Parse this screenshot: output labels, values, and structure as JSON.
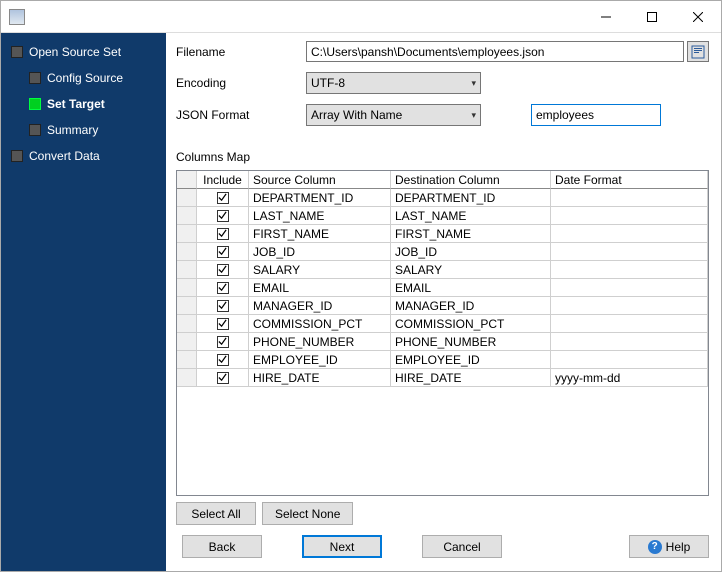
{
  "titlebar": {
    "title": ""
  },
  "sidebar": {
    "items": [
      {
        "label": "Open Source Set",
        "indent": 0,
        "active": false
      },
      {
        "label": "Config Source",
        "indent": 1,
        "active": false
      },
      {
        "label": "Set Target",
        "indent": 1,
        "active": true
      },
      {
        "label": "Summary",
        "indent": 1,
        "active": false
      },
      {
        "label": "Convert Data",
        "indent": 0,
        "active": false
      }
    ]
  },
  "form": {
    "filename_label": "Filename",
    "filename_value": "C:\\Users\\pansh\\Documents\\employees.json",
    "encoding_label": "Encoding",
    "encoding_value": "UTF-8",
    "format_label": "JSON Format",
    "format_value": "Array With Name",
    "array_name_value": "employees"
  },
  "columns_map": {
    "title": "Columns Map",
    "headers": {
      "include": "Include",
      "source": "Source Column",
      "dest": "Destination Column",
      "fmt": "Date Format"
    },
    "rows": [
      {
        "include": true,
        "src": "DEPARTMENT_ID",
        "dst": "DEPARTMENT_ID",
        "fmt": ""
      },
      {
        "include": true,
        "src": "LAST_NAME",
        "dst": "LAST_NAME",
        "fmt": ""
      },
      {
        "include": true,
        "src": "FIRST_NAME",
        "dst": "FIRST_NAME",
        "fmt": ""
      },
      {
        "include": true,
        "src": "JOB_ID",
        "dst": "JOB_ID",
        "fmt": ""
      },
      {
        "include": true,
        "src": "SALARY",
        "dst": "SALARY",
        "fmt": ""
      },
      {
        "include": true,
        "src": "EMAIL",
        "dst": "EMAIL",
        "fmt": ""
      },
      {
        "include": true,
        "src": "MANAGER_ID",
        "dst": "MANAGER_ID",
        "fmt": ""
      },
      {
        "include": true,
        "src": "COMMISSION_PCT",
        "dst": "COMMISSION_PCT",
        "fmt": ""
      },
      {
        "include": true,
        "src": "PHONE_NUMBER",
        "dst": "PHONE_NUMBER",
        "fmt": ""
      },
      {
        "include": true,
        "src": "EMPLOYEE_ID",
        "dst": "EMPLOYEE_ID",
        "fmt": ""
      },
      {
        "include": true,
        "src": "HIRE_DATE",
        "dst": "HIRE_DATE",
        "fmt": "yyyy-mm-dd"
      }
    ],
    "select_all": "Select All",
    "select_none": "Select None"
  },
  "wizard": {
    "back": "Back",
    "next": "Next",
    "cancel": "Cancel",
    "help": "Help"
  }
}
